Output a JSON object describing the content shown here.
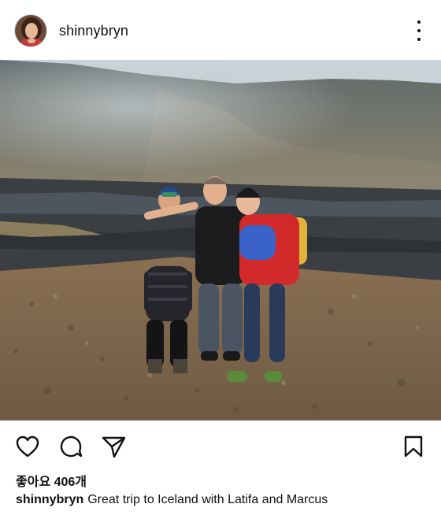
{
  "post": {
    "username": "shinnybryn",
    "likes_text": "좋아요 406개",
    "caption_user": "shinnybryn",
    "caption_text": "Great trip to Iceland with Latifa and Marcus"
  },
  "icons": {
    "more": "more-vertical-icon",
    "like": "heart-icon",
    "comment": "comment-icon",
    "share": "send-icon",
    "save": "bookmark-icon"
  },
  "colors": {
    "text": "#111111",
    "background": "#ffffff"
  }
}
